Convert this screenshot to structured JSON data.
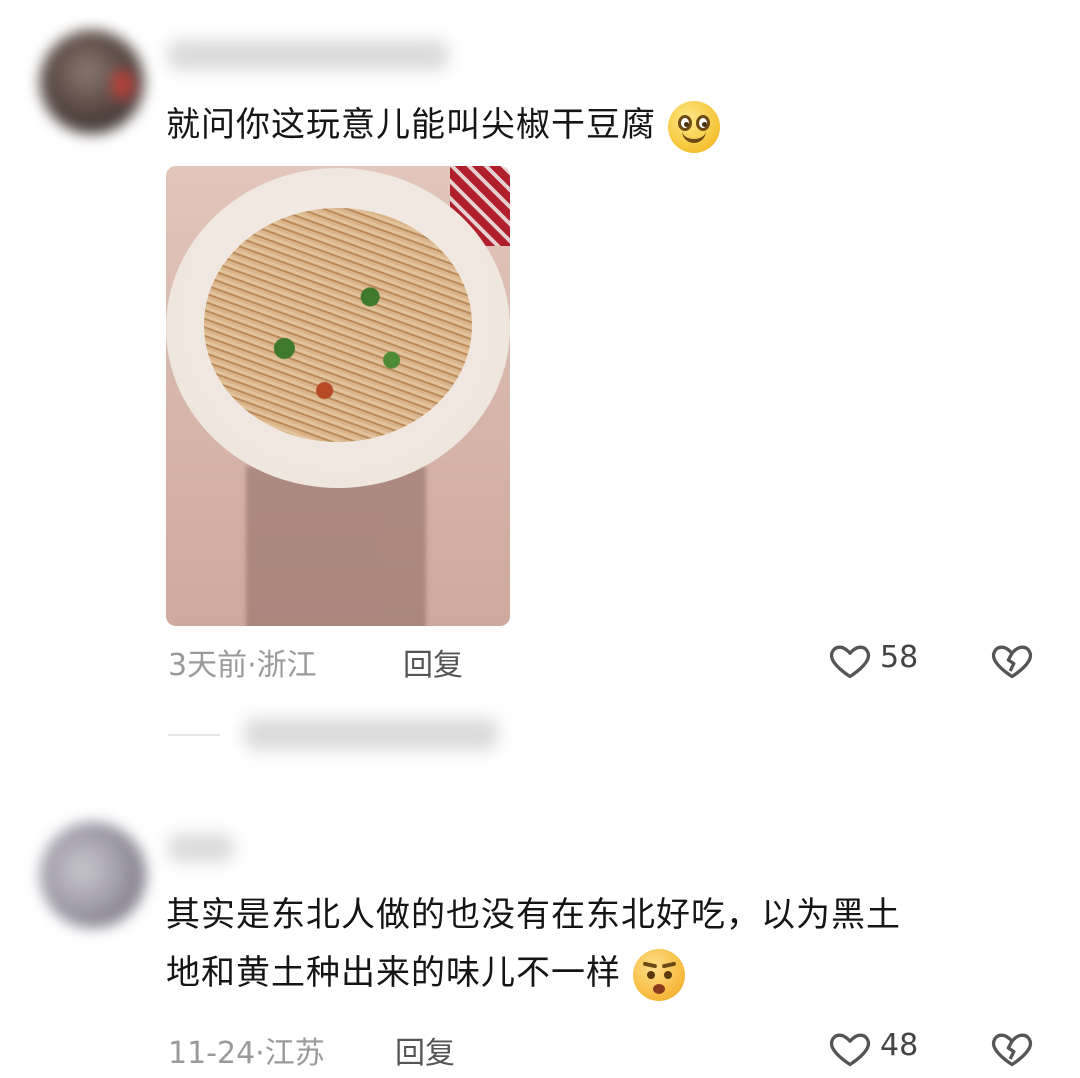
{
  "comments": [
    {
      "text": "就问你这玩意儿能叫尖椒干豆腐",
      "emoji": "smiling-face-icon",
      "meta": "3天前·浙江",
      "reply_label": "回复",
      "likes": "58"
    },
    {
      "text_line1": "其实是东北人做的也没有在东北好吃，以为黑土",
      "text_line2": "地和黄土种出来的味儿不一样",
      "emoji": "doubtful-face-icon",
      "meta": "11-24·江苏",
      "reply_label": "回复",
      "likes": "48"
    }
  ],
  "colors": {
    "text": "#151515",
    "meta": "#9a9a9a",
    "icon": "#555555"
  }
}
